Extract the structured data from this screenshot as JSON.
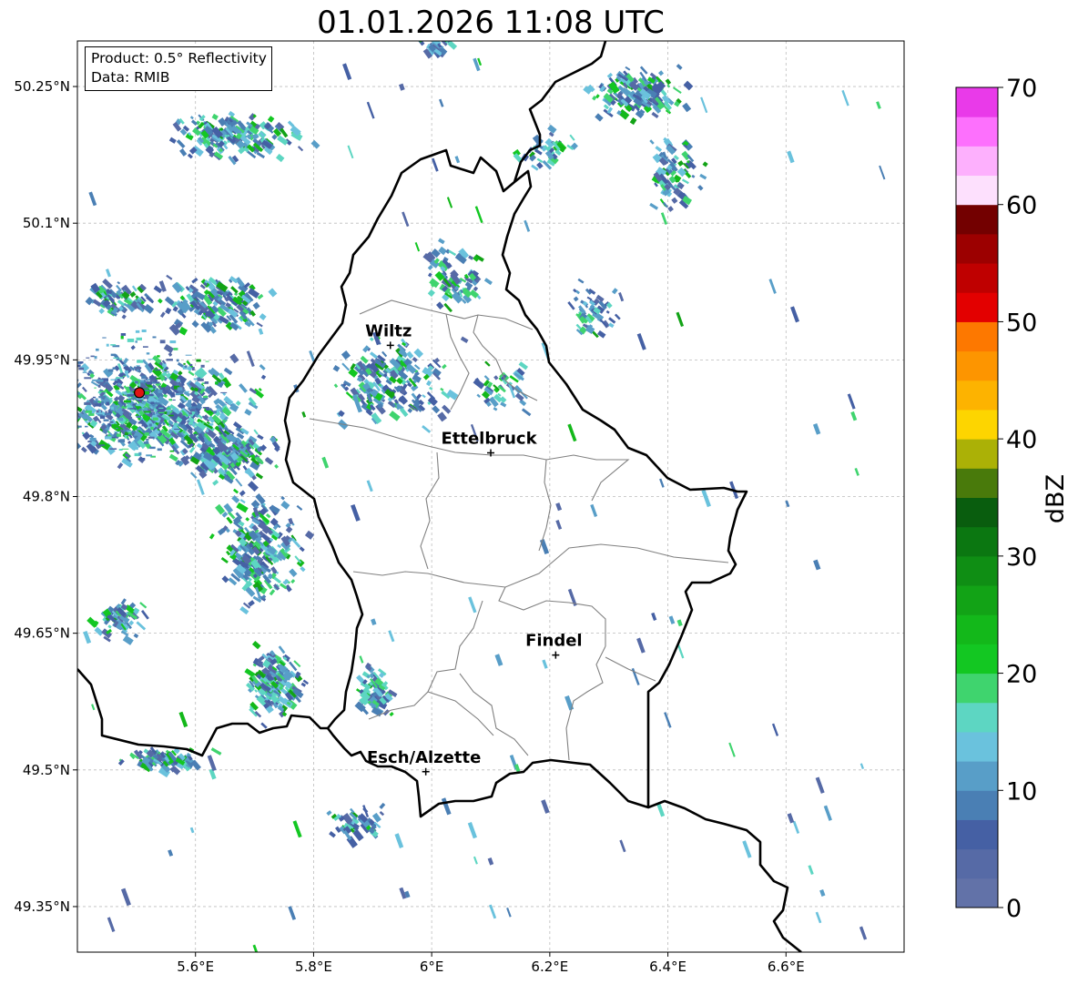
{
  "title": "01.01.2026 11:08 UTC",
  "info_box": {
    "product": "Product: 0.5° Reflectivity",
    "source": "Data: RMIB"
  },
  "map": {
    "lon_range": [
      5.4,
      6.8
    ],
    "lat_range": [
      49.3,
      50.3
    ],
    "lon_ticks": [
      "5.6°E",
      "5.8°E",
      "6°E",
      "6.2°E",
      "6.4°E",
      "6.6°E"
    ],
    "lat_ticks": [
      "50.25°N",
      "50.1°N",
      "49.95°N",
      "49.8°N",
      "49.65°N",
      "49.5°N",
      "49.35°N"
    ],
    "gridlines": true
  },
  "cities": [
    {
      "name": "Wiltz",
      "lon": 5.93,
      "lat": 49.966
    },
    {
      "name": "Ettelbruck",
      "lon": 6.1,
      "lat": 49.848
    },
    {
      "name": "Findel",
      "lon": 6.21,
      "lat": 49.626
    },
    {
      "name": "Esch/Alzette",
      "lon": 5.99,
      "lat": 49.498
    }
  ],
  "radar_site": {
    "lon": 5.505,
    "lat": 49.914
  },
  "colorbar": {
    "label": "dBZ",
    "ticks": [
      "0",
      "10",
      "20",
      "30",
      "40",
      "50",
      "60",
      "70"
    ],
    "min": 0,
    "max": 70,
    "step": 2.5,
    "colors": [
      "#6272a8",
      "#566aa6",
      "#4560a4",
      "#4a7fb4",
      "#589ec8",
      "#6ac2dd",
      "#5dd6c2",
      "#3fd46e",
      "#13c722",
      "#13b81a",
      "#12a316",
      "#0f8e14",
      "#0b7711",
      "#095d0e",
      "#497a0b",
      "#abb106",
      "#fdd500",
      "#fdb300",
      "#fd9500",
      "#fd7800",
      "#e30000",
      "#bf0000",
      "#9c0000",
      "#730000",
      "#fde0fd",
      "#fdb0fd",
      "#fd70fd",
      "#e93ae9"
    ]
  }
}
